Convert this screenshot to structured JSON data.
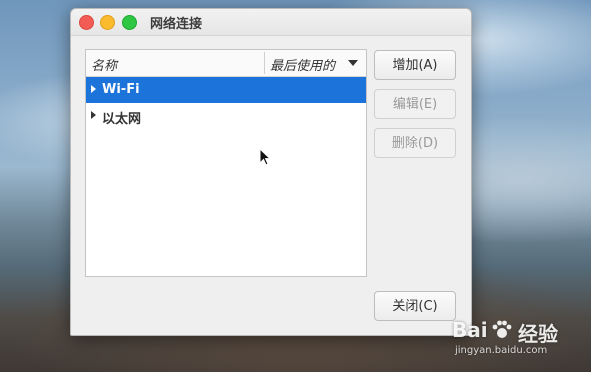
{
  "window": {
    "title": "网络连接"
  },
  "list": {
    "columns": {
      "name": "名称",
      "last_used": "最后使用的"
    },
    "items": [
      {
        "label": "Wi-Fi",
        "selected": true
      },
      {
        "label": "以太网",
        "selected": false
      }
    ]
  },
  "buttons": {
    "add": "增加(A)",
    "edit": "编辑(E)",
    "delete": "删除(D)",
    "close": "关闭(C)"
  },
  "watermark": {
    "brand": "Bai",
    "brand_suffix": "经验",
    "url": "jingyan.baidu.com"
  },
  "colors": {
    "selection": "#1c73d9"
  }
}
